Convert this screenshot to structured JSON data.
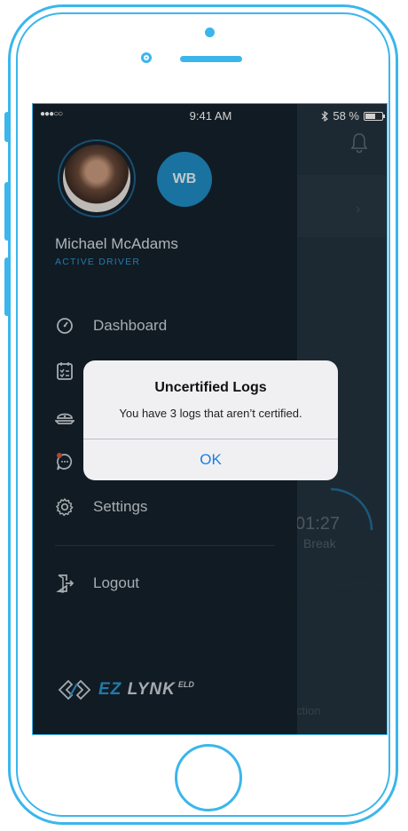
{
  "status_bar": {
    "signal": "●●●○○",
    "time": "9:41 AM",
    "battery_percent": "58 %"
  },
  "profile": {
    "initials": "WB",
    "name": "Michael McAdams",
    "role": "ACTIVE DRIVER"
  },
  "menu": [
    {
      "label": "Dashboard",
      "icon": "dashboard-icon"
    },
    {
      "label": "",
      "icon": "logs-icon"
    },
    {
      "label": "",
      "icon": "inspection-icon"
    },
    {
      "label": "",
      "icon": "messages-icon"
    },
    {
      "label": "Settings",
      "icon": "settings-icon"
    },
    {
      "label": "Logout",
      "icon": "logout-icon"
    }
  ],
  "logo": {
    "ez": "EZ",
    "lynk": "LYNK",
    "eld": "ELD"
  },
  "background": {
    "timer": "01:27",
    "timer_label": "Break",
    "bottom_text": "ction"
  },
  "alert": {
    "title": "Uncertified Logs",
    "message": "You have 3 logs that aren’t certified.",
    "ok_label": "OK"
  },
  "colors": {
    "accent": "#2a95cf",
    "frame": "#3bb6ec",
    "drawer_bg": "#15222c",
    "alert_button": "#1a7ee6"
  }
}
